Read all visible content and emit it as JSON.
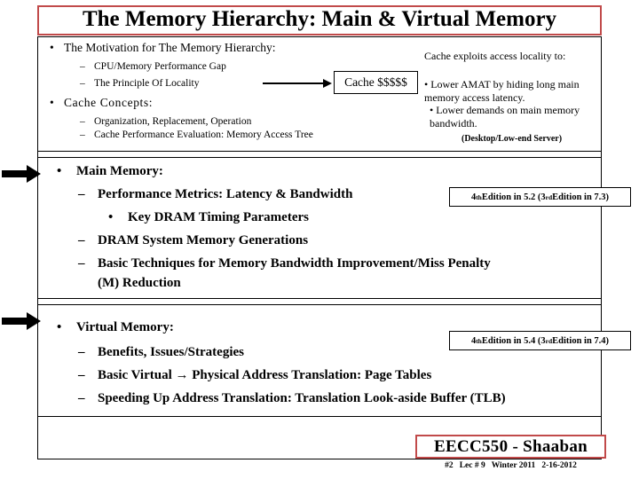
{
  "title": "The Memory Hierarchy: Main & Virtual Memory",
  "section1": {
    "bullet_motivation": "The Motivation for The Memory Hierarchy:",
    "sub_cpu_gap": "CPU/Memory Performance Gap",
    "sub_locality": "The Principle Of Locality",
    "bullet_concepts": "Cache Concepts:",
    "sub_org": "Organization, Replacement, Operation",
    "sub_eval": "Cache Performance Evaluation: Memory Access Tree",
    "cache_box": "Cache $$$$$",
    "note_1": "Cache exploits access locality to:",
    "note_2": "• Lower AMAT by hiding long main memory access latency.",
    "note_3": "• Lower demands on main memory bandwidth.",
    "note_4": "(Desktop/Low-end Server)"
  },
  "section2": {
    "bullet_main_memory": "Main Memory:",
    "sub_perf_metrics": "Performance Metrics: Latency & Bandwidth",
    "sub_sub_dram_timing": "Key DRAM Timing Parameters",
    "sub_dram_generations": "DRAM System Memory Generations",
    "sub_basic_techniques_1": "Basic Techniques  for Memory Bandwidth Improvement/Miss Penalty",
    "sub_basic_techniques_2": "(M) Reduction",
    "edition_note_prefix": "4",
    "edition_note_sup1": "th",
    "edition_note_mid": " Edition in 5.2 (3",
    "edition_note_sup2": "rd",
    "edition_note_end": " Edition in 7.3)"
  },
  "section3": {
    "bullet_virtual_memory": "Virtual Memory:",
    "sub_benefits": "Benefits, Issues/Strategies",
    "sub_translation": "Basic Virtual → Physical Address Translation: Page Tables",
    "sub_tlb": "Speeding Up Address Translation: Translation Look-aside Buffer (TLB)",
    "edition_note_prefix": "4",
    "edition_note_sup1": "th",
    "edition_note_mid": " Edition in 5.4 (3",
    "edition_note_sup2": "rd",
    "edition_note_end": " Edition in 7.4)"
  },
  "footer": {
    "course_label": "EECC550 - Shaaban",
    "slide_info_1": "#2",
    "slide_info_2": "Lec # 9",
    "slide_info_3": "Winter 2011",
    "slide_info_4": "2-16-2012"
  },
  "glyphs": {
    "bullet": "•",
    "dash": "–",
    "subbullet": "•"
  },
  "colors": {
    "accent_border": "#c14a4a",
    "text": "#000000",
    "background": "#ffffff"
  }
}
